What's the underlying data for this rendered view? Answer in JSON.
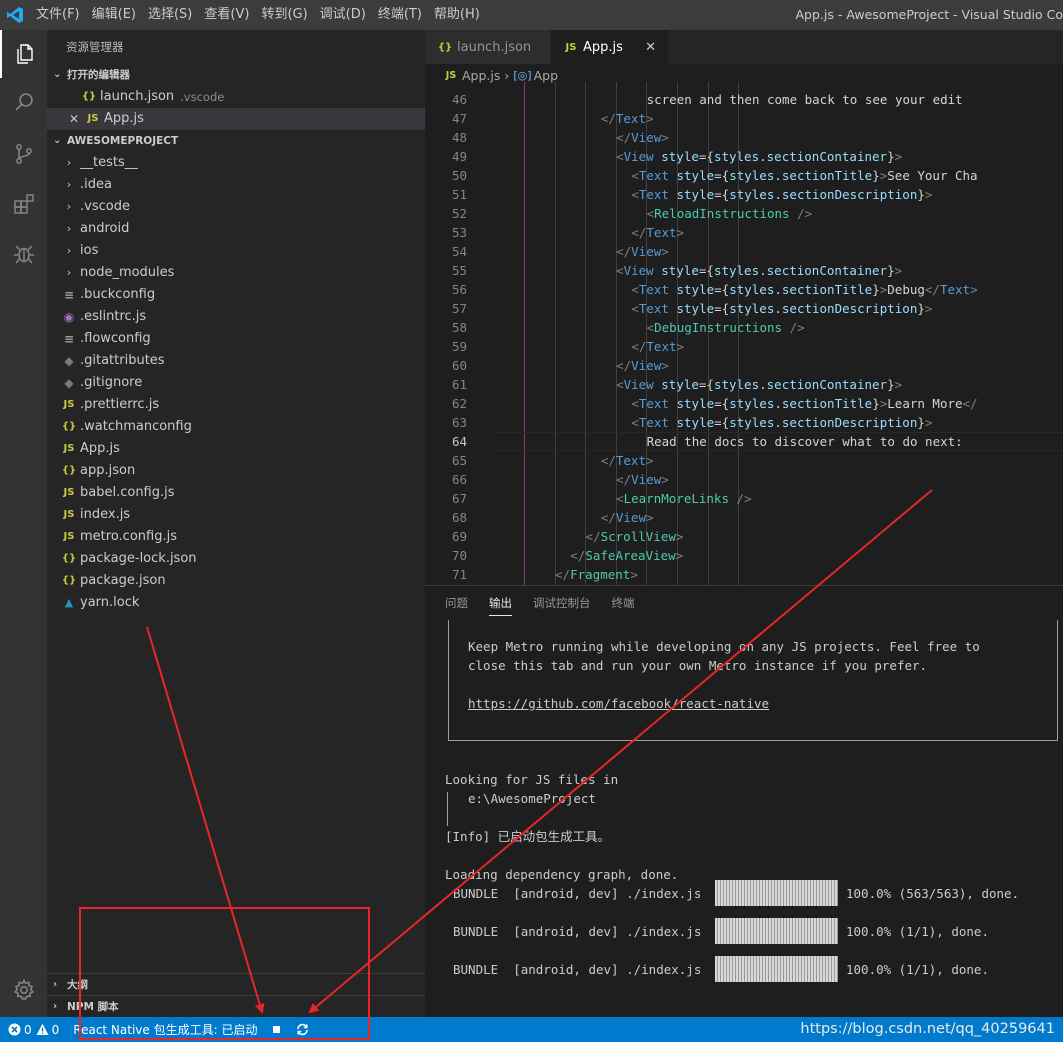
{
  "titlebar": {
    "menu": [
      "文件(F)",
      "编辑(E)",
      "选择(S)",
      "查看(V)",
      "转到(G)",
      "调试(D)",
      "终端(T)",
      "帮助(H)"
    ],
    "window_title": "App.js - AwesomeProject - Visual Studio Co"
  },
  "activity": {
    "items": [
      "explorer-icon",
      "search-icon",
      "source-control-icon",
      "extensions-icon",
      "debug-icon",
      "gear-icon"
    ]
  },
  "sidebar": {
    "title": "资源管理器",
    "open_editors": {
      "header": "打开的编辑器",
      "items": [
        {
          "icon": "{}",
          "name": "launch.json",
          "desc": ".vscode"
        },
        {
          "icon": "JS",
          "name": "App.js",
          "desc": ""
        }
      ]
    },
    "project": {
      "header": "AWESOMEPROJECT",
      "folders": [
        "__tests__",
        ".idea",
        ".vscode",
        "android",
        "ios",
        "node_modules"
      ],
      "files": [
        {
          "icon": "≡",
          "name": ".buckconfig"
        },
        {
          "icon": "◉",
          "name": ".eslintrc.js"
        },
        {
          "icon": "≡",
          "name": ".flowconfig"
        },
        {
          "icon": "◆",
          "name": ".gitattributes"
        },
        {
          "icon": "◆",
          "name": ".gitignore"
        },
        {
          "icon": "JS",
          "name": ".prettierrc.js"
        },
        {
          "icon": "{}",
          "name": ".watchmanconfig"
        },
        {
          "icon": "JS",
          "name": "App.js"
        },
        {
          "icon": "{}",
          "name": "app.json"
        },
        {
          "icon": "JS",
          "name": "babel.config.js"
        },
        {
          "icon": "JS",
          "name": "index.js"
        },
        {
          "icon": "JS",
          "name": "metro.config.js"
        },
        {
          "icon": "{}",
          "name": "package-lock.json"
        },
        {
          "icon": "{}",
          "name": "package.json"
        },
        {
          "icon": "▲",
          "name": "yarn.lock"
        }
      ]
    },
    "outline_header": "大纲",
    "npm_header": "NPM 脚本"
  },
  "tabs": [
    {
      "icon": "{}",
      "label": "launch.json"
    },
    {
      "icon": "JS",
      "label": "App.js"
    }
  ],
  "breadcrumb": {
    "file": "App.js",
    "symbol": "App"
  },
  "code": {
    "current_line": 64,
    "lines": [
      {
        "n": 46,
        "indent": 20,
        "parts": [
          [
            "t-text",
            "screen and then come back to see your edit"
          ]
        ]
      },
      {
        "n": 47,
        "indent": 14,
        "parts": [
          [
            "t-br",
            "</"
          ],
          [
            "t-tag",
            "Text"
          ],
          [
            "t-br",
            ">"
          ]
        ]
      },
      {
        "n": 48,
        "indent": 16,
        "parts": [
          [
            "t-br",
            "</"
          ],
          [
            "t-tag",
            "View"
          ],
          [
            "t-br",
            ">"
          ]
        ]
      },
      {
        "n": 49,
        "indent": 16,
        "parts": [
          [
            "t-br",
            "<"
          ],
          [
            "t-tag",
            "View"
          ],
          [
            "t-text",
            " "
          ],
          [
            "t-attr",
            "style"
          ],
          [
            "t-pun",
            "={"
          ],
          [
            "t-attr",
            "styles"
          ],
          [
            "t-pun",
            "."
          ],
          [
            "t-attr",
            "sectionContainer"
          ],
          [
            "t-pun",
            "}"
          ],
          [
            "t-br",
            ">"
          ]
        ]
      },
      {
        "n": 50,
        "indent": 18,
        "parts": [
          [
            "t-br",
            "<"
          ],
          [
            "t-tag",
            "Text"
          ],
          [
            "t-text",
            " "
          ],
          [
            "t-attr",
            "style"
          ],
          [
            "t-pun",
            "={"
          ],
          [
            "t-attr",
            "styles"
          ],
          [
            "t-pun",
            "."
          ],
          [
            "t-attr",
            "sectionTitle"
          ],
          [
            "t-pun",
            "}"
          ],
          [
            "t-br",
            ">"
          ],
          [
            "t-text",
            "See Your Cha"
          ]
        ]
      },
      {
        "n": 51,
        "indent": 18,
        "parts": [
          [
            "t-br",
            "<"
          ],
          [
            "t-tag",
            "Text"
          ],
          [
            "t-text",
            " "
          ],
          [
            "t-attr",
            "style"
          ],
          [
            "t-pun",
            "={"
          ],
          [
            "t-attr",
            "styles"
          ],
          [
            "t-pun",
            "."
          ],
          [
            "t-attr",
            "sectionDescription"
          ],
          [
            "t-pun",
            "}"
          ],
          [
            "t-br",
            ">"
          ]
        ]
      },
      {
        "n": 52,
        "indent": 20,
        "parts": [
          [
            "t-br",
            "<"
          ],
          [
            "t-cmp",
            "ReloadInstructions"
          ],
          [
            "t-text",
            " "
          ],
          [
            "t-br",
            "/>"
          ]
        ]
      },
      {
        "n": 53,
        "indent": 18,
        "parts": [
          [
            "t-br",
            "</"
          ],
          [
            "t-tag",
            "Text"
          ],
          [
            "t-br",
            ">"
          ]
        ]
      },
      {
        "n": 54,
        "indent": 16,
        "parts": [
          [
            "t-br",
            "</"
          ],
          [
            "t-tag",
            "View"
          ],
          [
            "t-br",
            ">"
          ]
        ]
      },
      {
        "n": 55,
        "indent": 16,
        "parts": [
          [
            "t-br",
            "<"
          ],
          [
            "t-tag",
            "View"
          ],
          [
            "t-text",
            " "
          ],
          [
            "t-attr",
            "style"
          ],
          [
            "t-pun",
            "={"
          ],
          [
            "t-attr",
            "styles"
          ],
          [
            "t-pun",
            "."
          ],
          [
            "t-attr",
            "sectionContainer"
          ],
          [
            "t-pun",
            "}"
          ],
          [
            "t-br",
            ">"
          ]
        ]
      },
      {
        "n": 56,
        "indent": 18,
        "parts": [
          [
            "t-br",
            "<"
          ],
          [
            "t-tag",
            "Text"
          ],
          [
            "t-text",
            " "
          ],
          [
            "t-attr",
            "style"
          ],
          [
            "t-pun",
            "={"
          ],
          [
            "t-attr",
            "styles"
          ],
          [
            "t-pun",
            "."
          ],
          [
            "t-attr",
            "sectionTitle"
          ],
          [
            "t-pun",
            "}"
          ],
          [
            "t-br",
            ">"
          ],
          [
            "t-text",
            "Debug"
          ],
          [
            "t-br",
            "</"
          ],
          [
            "t-tag",
            "Text"
          ],
          [
            "t-br",
            ">"
          ]
        ]
      },
      {
        "n": 57,
        "indent": 18,
        "parts": [
          [
            "t-br",
            "<"
          ],
          [
            "t-tag",
            "Text"
          ],
          [
            "t-text",
            " "
          ],
          [
            "t-attr",
            "style"
          ],
          [
            "t-pun",
            "={"
          ],
          [
            "t-attr",
            "styles"
          ],
          [
            "t-pun",
            "."
          ],
          [
            "t-attr",
            "sectionDescription"
          ],
          [
            "t-pun",
            "}"
          ],
          [
            "t-br",
            ">"
          ]
        ]
      },
      {
        "n": 58,
        "indent": 20,
        "parts": [
          [
            "t-br",
            "<"
          ],
          [
            "t-cmp",
            "DebugInstructions"
          ],
          [
            "t-text",
            " "
          ],
          [
            "t-br",
            "/>"
          ]
        ]
      },
      {
        "n": 59,
        "indent": 18,
        "parts": [
          [
            "t-br",
            "</"
          ],
          [
            "t-tag",
            "Text"
          ],
          [
            "t-br",
            ">"
          ]
        ]
      },
      {
        "n": 60,
        "indent": 16,
        "parts": [
          [
            "t-br",
            "</"
          ],
          [
            "t-tag",
            "View"
          ],
          [
            "t-br",
            ">"
          ]
        ]
      },
      {
        "n": 61,
        "indent": 16,
        "parts": [
          [
            "t-br",
            "<"
          ],
          [
            "t-tag",
            "View"
          ],
          [
            "t-text",
            " "
          ],
          [
            "t-attr",
            "style"
          ],
          [
            "t-pun",
            "={"
          ],
          [
            "t-attr",
            "styles"
          ],
          [
            "t-pun",
            "."
          ],
          [
            "t-attr",
            "sectionContainer"
          ],
          [
            "t-pun",
            "}"
          ],
          [
            "t-br",
            ">"
          ]
        ]
      },
      {
        "n": 62,
        "indent": 18,
        "parts": [
          [
            "t-br",
            "<"
          ],
          [
            "t-tag",
            "Text"
          ],
          [
            "t-text",
            " "
          ],
          [
            "t-attr",
            "style"
          ],
          [
            "t-pun",
            "={"
          ],
          [
            "t-attr",
            "styles"
          ],
          [
            "t-pun",
            "."
          ],
          [
            "t-attr",
            "sectionTitle"
          ],
          [
            "t-pun",
            "}"
          ],
          [
            "t-br",
            ">"
          ],
          [
            "t-text",
            "Learn More"
          ],
          [
            "t-br",
            "</"
          ]
        ]
      },
      {
        "n": 63,
        "indent": 18,
        "parts": [
          [
            "t-br",
            "<"
          ],
          [
            "t-tag",
            "Text"
          ],
          [
            "t-text",
            " "
          ],
          [
            "t-attr",
            "style"
          ],
          [
            "t-pun",
            "={"
          ],
          [
            "t-attr",
            "styles"
          ],
          [
            "t-pun",
            "."
          ],
          [
            "t-attr",
            "sectionDescription"
          ],
          [
            "t-pun",
            "}"
          ],
          [
            "t-br",
            ">"
          ]
        ]
      },
      {
        "n": 64,
        "indent": 20,
        "parts": [
          [
            "t-text",
            "Read the docs to discover what to do next:"
          ]
        ]
      },
      {
        "n": 65,
        "indent": 14,
        "parts": [
          [
            "t-br",
            "</"
          ],
          [
            "t-tag",
            "Text"
          ],
          [
            "t-br",
            ">"
          ]
        ]
      },
      {
        "n": 66,
        "indent": 16,
        "parts": [
          [
            "t-br",
            "</"
          ],
          [
            "t-tag",
            "View"
          ],
          [
            "t-br",
            ">"
          ]
        ]
      },
      {
        "n": 67,
        "indent": 16,
        "parts": [
          [
            "t-br",
            "<"
          ],
          [
            "t-cmp",
            "LearnMoreLinks"
          ],
          [
            "t-text",
            " "
          ],
          [
            "t-br",
            "/>"
          ]
        ]
      },
      {
        "n": 68,
        "indent": 14,
        "parts": [
          [
            "t-br",
            "</"
          ],
          [
            "t-tag",
            "View"
          ],
          [
            "t-br",
            ">"
          ]
        ]
      },
      {
        "n": 69,
        "indent": 12,
        "parts": [
          [
            "t-br",
            "</"
          ],
          [
            "t-cmp",
            "ScrollView"
          ],
          [
            "t-br",
            ">"
          ]
        ]
      },
      {
        "n": 70,
        "indent": 10,
        "parts": [
          [
            "t-br",
            "</"
          ],
          [
            "t-cmp",
            "SafeAreaView"
          ],
          [
            "t-br",
            ">"
          ]
        ]
      },
      {
        "n": 71,
        "indent": 8,
        "parts": [
          [
            "t-br",
            "</"
          ],
          [
            "t-cmp",
            "Fragment"
          ],
          [
            "t-br",
            ">"
          ]
        ]
      }
    ]
  },
  "panel": {
    "tabs": [
      "问题",
      "输出",
      "调试控制台",
      "终端"
    ],
    "active_tab": 1,
    "output": {
      "box_lines": [
        "Keep Metro running while developing on any JS projects. Feel free to",
        "close this tab and run your own Metro instance if you prefer.",
        "",
        "https://github.com/facebook/react-native"
      ],
      "looking": "Looking for JS files in",
      "path": "e:\\AwesomeProject",
      "info": "[Info] 已启动包生成工具。",
      "loading": "Loading dependency graph, done.",
      "bundles": [
        {
          "label": "BUNDLE  [android, dev] ./index.js",
          "progress": 1.0,
          "result": "100.0% (563/563), done."
        },
        {
          "label": "BUNDLE  [android, dev] ./index.js",
          "progress": 1.0,
          "result": "100.0% (1/1), done."
        },
        {
          "label": "BUNDLE  [android, dev] ./index.js",
          "progress": 1.0,
          "result": "100.0% (1/1), done."
        }
      ]
    }
  },
  "statusbar": {
    "errors": "0",
    "warnings": "0",
    "packager": "React Native 包生成工具: 已启动",
    "watermark": "https://blog.csdn.net/qq_40259641"
  },
  "colors": {
    "status_bar": "#007acc",
    "annotation_red": "#e8262a",
    "accent_js": "#cbcb41"
  }
}
